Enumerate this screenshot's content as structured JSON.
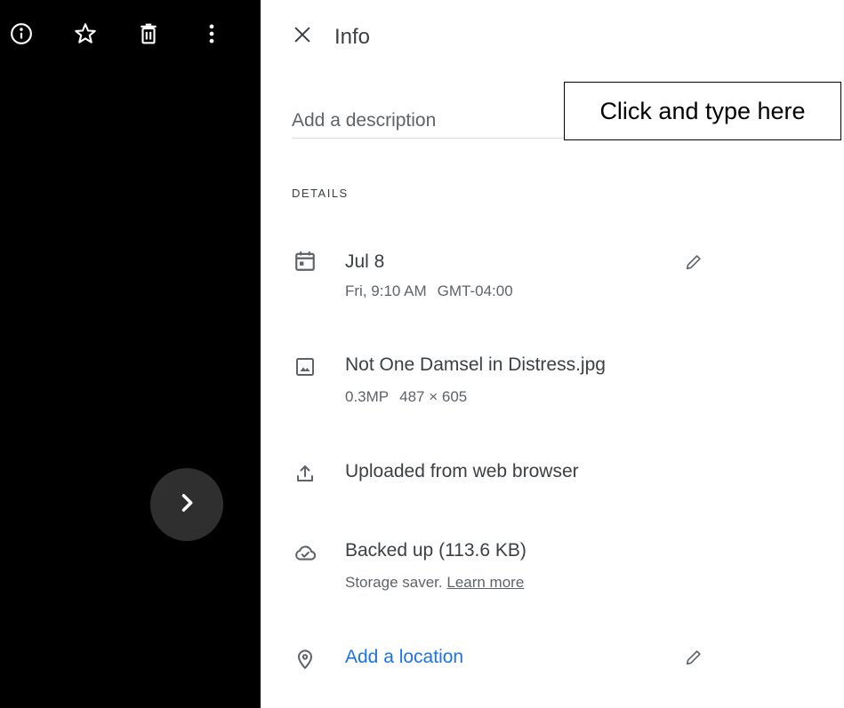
{
  "toolbar": {
    "icons": [
      "info-icon",
      "star-icon",
      "delete-icon",
      "more-vert-icon"
    ]
  },
  "viewer": {
    "next_icon": "chevron-right-icon"
  },
  "panel": {
    "title": "Info",
    "close_icon": "close-icon",
    "description_placeholder": "Add a description",
    "tooltip": "Click and type here",
    "section_label": "DETAILS"
  },
  "details": {
    "date": {
      "icon": "calendar-icon",
      "primary": "Jul 8",
      "day_time": "Fri, 9:10 AM",
      "timezone": "GMT-04:00",
      "edit_icon": "edit-icon"
    },
    "file": {
      "icon": "image-icon",
      "name": "Not One Damsel in Distress.jpg",
      "megapixels": "0.3MP",
      "dimensions": "487 × 605"
    },
    "upload": {
      "icon": "upload-icon",
      "text": "Uploaded from web browser"
    },
    "backup": {
      "icon": "cloud-done-icon",
      "text": "Backed up (113.6 KB)",
      "storage": "Storage saver.",
      "learn_more": "Learn more"
    },
    "location": {
      "icon": "location-pin-icon",
      "text": "Add a location",
      "edit_icon": "edit-icon"
    }
  },
  "colors": {
    "viewer_bg": "#000000",
    "next_button_bg": "#2f2f2f",
    "text_primary": "#3c4043",
    "text_secondary": "#5f6368",
    "link_blue": "#1a73e8"
  }
}
